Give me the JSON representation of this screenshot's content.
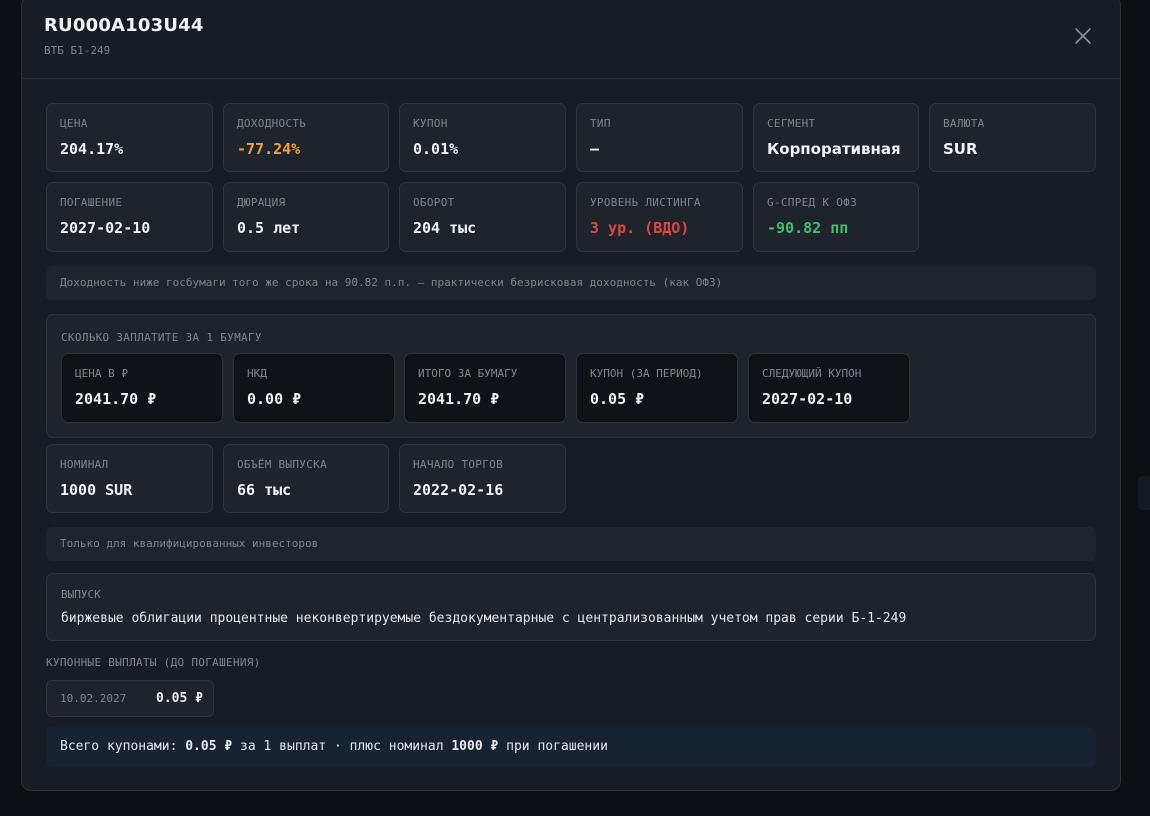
{
  "header": {
    "title": "RU000A103U44",
    "subtitle": "ВТБ Б1-249"
  },
  "stats_row1": [
    {
      "label": "ЦЕНА",
      "value": "204.17%"
    },
    {
      "label": "ДОХОДНОСТЬ",
      "value": "-77.24%"
    },
    {
      "label": "КУПОН",
      "value": "0.01%"
    },
    {
      "label": "ТИП",
      "value": "—"
    },
    {
      "label": "СЕГМЕНТ",
      "value": "Корпоративная"
    },
    {
      "label": "ВАЛЮТА",
      "value": "SUR"
    }
  ],
  "stats_row2": [
    {
      "label": "ПОГАШЕНИЕ",
      "value": "2027-02-10"
    },
    {
      "label": "ДЮРАЦИЯ",
      "value": "0.5 лет"
    },
    {
      "label": "ОБОРОТ",
      "value": "204 тыс"
    },
    {
      "label": "УРОВЕНЬ ЛИСТИНГА",
      "value": "3 ур. (ВДО)"
    },
    {
      "label": "G-СПРЕД К ОФЗ",
      "value": "-90.82 пп"
    }
  ],
  "spread_note": "Доходность ниже госбумаги того же срока на 90.82 п.п. — практически безрисковая доходность (как ОФЗ)",
  "payment": {
    "title": "СКОЛЬКО ЗАПЛАТИТЕ ЗА 1 БУМАГУ",
    "items": [
      {
        "label": "ЦЕНА В ₽",
        "value": "2041.70 ₽"
      },
      {
        "label": "НКД",
        "value": "0.00 ₽"
      },
      {
        "label": "ИТОГО ЗА БУМАГУ",
        "value": "2041.70 ₽"
      },
      {
        "label": "КУПОН (ЗА ПЕРИОД)",
        "value": "0.05 ₽"
      },
      {
        "label": "СЛЕДУЮЩИЙ КУПОН",
        "value": "2027-02-10"
      }
    ]
  },
  "stats_row3": [
    {
      "label": "НОМИНАЛ",
      "value": "1000 SUR"
    },
    {
      "label": "ОБЪЁМ ВЫПУСКА",
      "value": "66 тыс"
    },
    {
      "label": "НАЧАЛО ТОРГОВ",
      "value": "2022-02-16"
    }
  ],
  "qual_note": "Только для квалифицированных инвесторов",
  "issue": {
    "label": "ВЫПУСК",
    "value": "биржевые облигации процентные неконвертируемые бездокументарные с централизованным учетом прав серии Б-1-249"
  },
  "coupons": {
    "title": "КУПОННЫЕ ВЫПЛАТЫ (ДО ПОГАШЕНИЯ)",
    "items": [
      {
        "date": "10.02.2027",
        "amount": "0.05 ₽"
      }
    ]
  },
  "summary": {
    "prefix": "Всего купонами: ",
    "total": "0.05 ₽",
    "middle": " за 1 выплат · плюс номинал ",
    "nominal": "1000 ₽",
    "suffix": " при погашении"
  },
  "colors": {
    "yield_negative": "#f0a23a",
    "listing_risk": "#e0453e",
    "spread": "#3ec06a",
    "total_accent": "#5e9cf0"
  }
}
